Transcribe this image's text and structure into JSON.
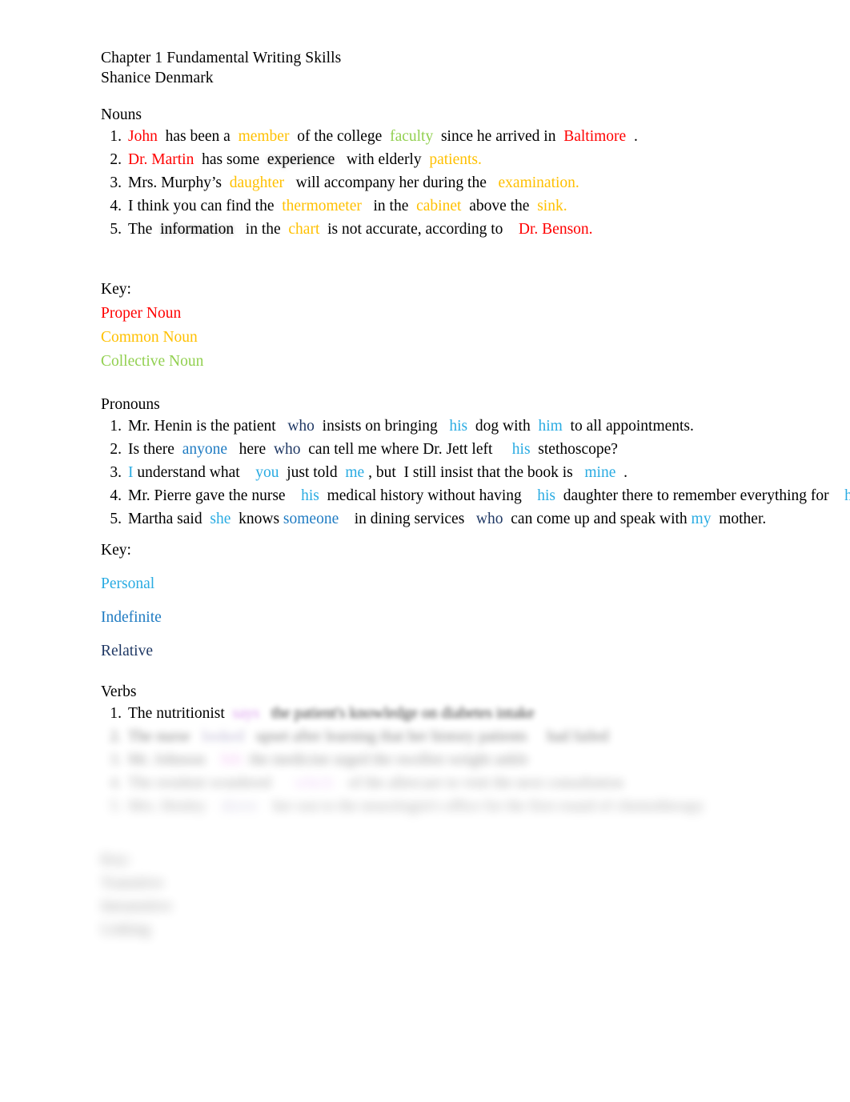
{
  "document": {
    "title_line": "Chapter 1 Fundamental Writing Skills",
    "author_line": "Shanice Denmark"
  },
  "sections": {
    "nouns": {
      "heading": "Nouns",
      "items": [
        {
          "number": "1.",
          "parts": [
            {
              "text": "John",
              "type": "proper"
            },
            {
              "text": "  has been a  ",
              "type": "plain"
            },
            {
              "text": "member",
              "type": "common"
            },
            {
              "text": "  of the college  ",
              "type": "plain"
            },
            {
              "text": "faculty",
              "type": "collective"
            },
            {
              "text": "  since he arrived in  ",
              "type": "plain"
            },
            {
              "text": "Baltimore",
              "type": "proper"
            },
            {
              "text": "  .",
              "type": "plain"
            }
          ]
        },
        {
          "number": "2.",
          "parts": [
            {
              "text": "Dr. Martin",
              "type": "proper"
            },
            {
              "text": "  has some  ",
              "type": "plain"
            },
            {
              "text": "experience",
              "type": "shadow"
            },
            {
              "text": "   with elderly  ",
              "type": "plain"
            },
            {
              "text": "patients.",
              "type": "common"
            }
          ]
        },
        {
          "number": "3.",
          "parts": [
            {
              "text": "Mrs. Murphy’s  ",
              "type": "plain"
            },
            {
              "text": "daughter",
              "type": "common"
            },
            {
              "text": "   will accompany her during the   ",
              "type": "plain"
            },
            {
              "text": "examination.",
              "type": "common"
            }
          ]
        },
        {
          "number": "4.",
          "parts": [
            {
              "text": "I think you can find the  ",
              "type": "plain"
            },
            {
              "text": "thermometer",
              "type": "common"
            },
            {
              "text": "   in the  ",
              "type": "plain"
            },
            {
              "text": "cabinet",
              "type": "common"
            },
            {
              "text": "  above the  ",
              "type": "plain"
            },
            {
              "text": "sink.",
              "type": "common"
            }
          ]
        },
        {
          "number": "5.",
          "parts": [
            {
              "text": "The  ",
              "type": "plain"
            },
            {
              "text": "information",
              "type": "shadow"
            },
            {
              "text": "   in the  ",
              "type": "plain"
            },
            {
              "text": "chart",
              "type": "common"
            },
            {
              "text": "  is not accurate, according to    ",
              "type": "plain"
            },
            {
              "text": "Dr. Benson.",
              "type": "proper"
            }
          ]
        }
      ],
      "key": {
        "title": "Key:",
        "entries": [
          {
            "label": "Proper Noun",
            "type": "proper",
            "color": "#FF0000"
          },
          {
            "label": "Common Noun",
            "type": "common",
            "color": "#FFC000"
          },
          {
            "label": "Collective Noun",
            "type": "collective",
            "color": "#92D050"
          }
        ]
      }
    },
    "pronouns": {
      "heading": "Pronouns",
      "items": [
        {
          "number": "1.",
          "parts": [
            {
              "text": "Mr. Henin is the patient   ",
              "type": "plain"
            },
            {
              "text": "who",
              "type": "relative"
            },
            {
              "text": "  insists on bringing   ",
              "type": "plain"
            },
            {
              "text": "his",
              "type": "personal"
            },
            {
              "text": "  dog with  ",
              "type": "plain"
            },
            {
              "text": "him",
              "type": "personal"
            },
            {
              "text": "  to all appointments.",
              "type": "plain"
            }
          ]
        },
        {
          "number": "2.",
          "parts": [
            {
              "text": "Is there  ",
              "type": "plain"
            },
            {
              "text": "anyone",
              "type": "indefinite"
            },
            {
              "text": "   here  ",
              "type": "plain"
            },
            {
              "text": "who",
              "type": "relative"
            },
            {
              "text": "  can tell me where Dr. Jett left     ",
              "type": "plain"
            },
            {
              "text": "his",
              "type": "personal"
            },
            {
              "text": "  stethoscope?",
              "type": "plain"
            }
          ]
        },
        {
          "number": "3.",
          "parts": [
            {
              "text": "I",
              "type": "personal"
            },
            {
              "text": " understand what    ",
              "type": "plain"
            },
            {
              "text": "you",
              "type": "personal"
            },
            {
              "text": "  just told  ",
              "type": "plain"
            },
            {
              "text": "me",
              "type": "personal"
            },
            {
              "text": " , but  I still insist that the book is   ",
              "type": "plain"
            },
            {
              "text": "mine",
              "type": "personal"
            },
            {
              "text": "  .",
              "type": "plain"
            }
          ]
        },
        {
          "number": "4.",
          "parts": [
            {
              "text": "Mr. Pierre gave the nurse    ",
              "type": "plain"
            },
            {
              "text": "his",
              "type": "personal"
            },
            {
              "text": "  medical history without having    ",
              "type": "plain"
            },
            {
              "text": "his",
              "type": "personal"
            },
            {
              "text": "  daughter there to remember everything for    ",
              "type": "plain"
            },
            {
              "text": "him",
              "type": "personal"
            },
            {
              "text": " .",
              "type": "plain"
            }
          ]
        },
        {
          "number": "5.",
          "parts": [
            {
              "text": "Martha said  ",
              "type": "plain"
            },
            {
              "text": "she",
              "type": "personal"
            },
            {
              "text": "  knows ",
              "type": "plain"
            },
            {
              "text": "someone",
              "type": "indefinite"
            },
            {
              "text": "    in dining services   ",
              "type": "plain"
            },
            {
              "text": "who",
              "type": "relative"
            },
            {
              "text": "  can come up and speak with ",
              "type": "plain"
            },
            {
              "text": "my",
              "type": "personal"
            },
            {
              "text": "  mother.",
              "type": "plain"
            }
          ]
        }
      ],
      "key": {
        "title": "Key:",
        "entries": [
          {
            "label": "Personal",
            "type": "personal",
            "color": "#29ABE2"
          },
          {
            "label": "Indefinite",
            "type": "indefinite",
            "color": "#1F7BC2"
          },
          {
            "label": "Relative",
            "type": "relative",
            "color": "#1F3864"
          }
        ]
      }
    },
    "verbs": {
      "heading": "Verbs",
      "items": [
        {
          "number": "1.",
          "legible": "The nutritionist",
          "illegible": "  says   the patient's knowledge on diabetes intake",
          "blur_level": 1
        },
        {
          "number": "2.",
          "legible": "",
          "illegible": "The nurse   looked   upset after learning that her history patients     had failed",
          "blur_level": 3
        },
        {
          "number": "3.",
          "legible": "",
          "illegible": "Mr. Johnson    felt  the medicine urged the swollen weight ankle",
          "blur_level": 4
        },
        {
          "number": "4.",
          "legible": "",
          "illegible": "The resident wondered      which    of the aftercare to visit the next consultation",
          "blur_level": 5
        },
        {
          "number": "5.",
          "legible": "",
          "illegible": "Mrs. Henley    drove    her son to the neurologist's office for the first round of chemotherapy",
          "blur_level": 6
        }
      ],
      "key": {
        "title": "Key:",
        "entries": [
          {
            "label": "Transitive",
            "blur_level": 7
          },
          {
            "label": "Intransitive",
            "blur_level": 7
          },
          {
            "label": "Linking",
            "blur_level": 7
          }
        ]
      }
    }
  }
}
